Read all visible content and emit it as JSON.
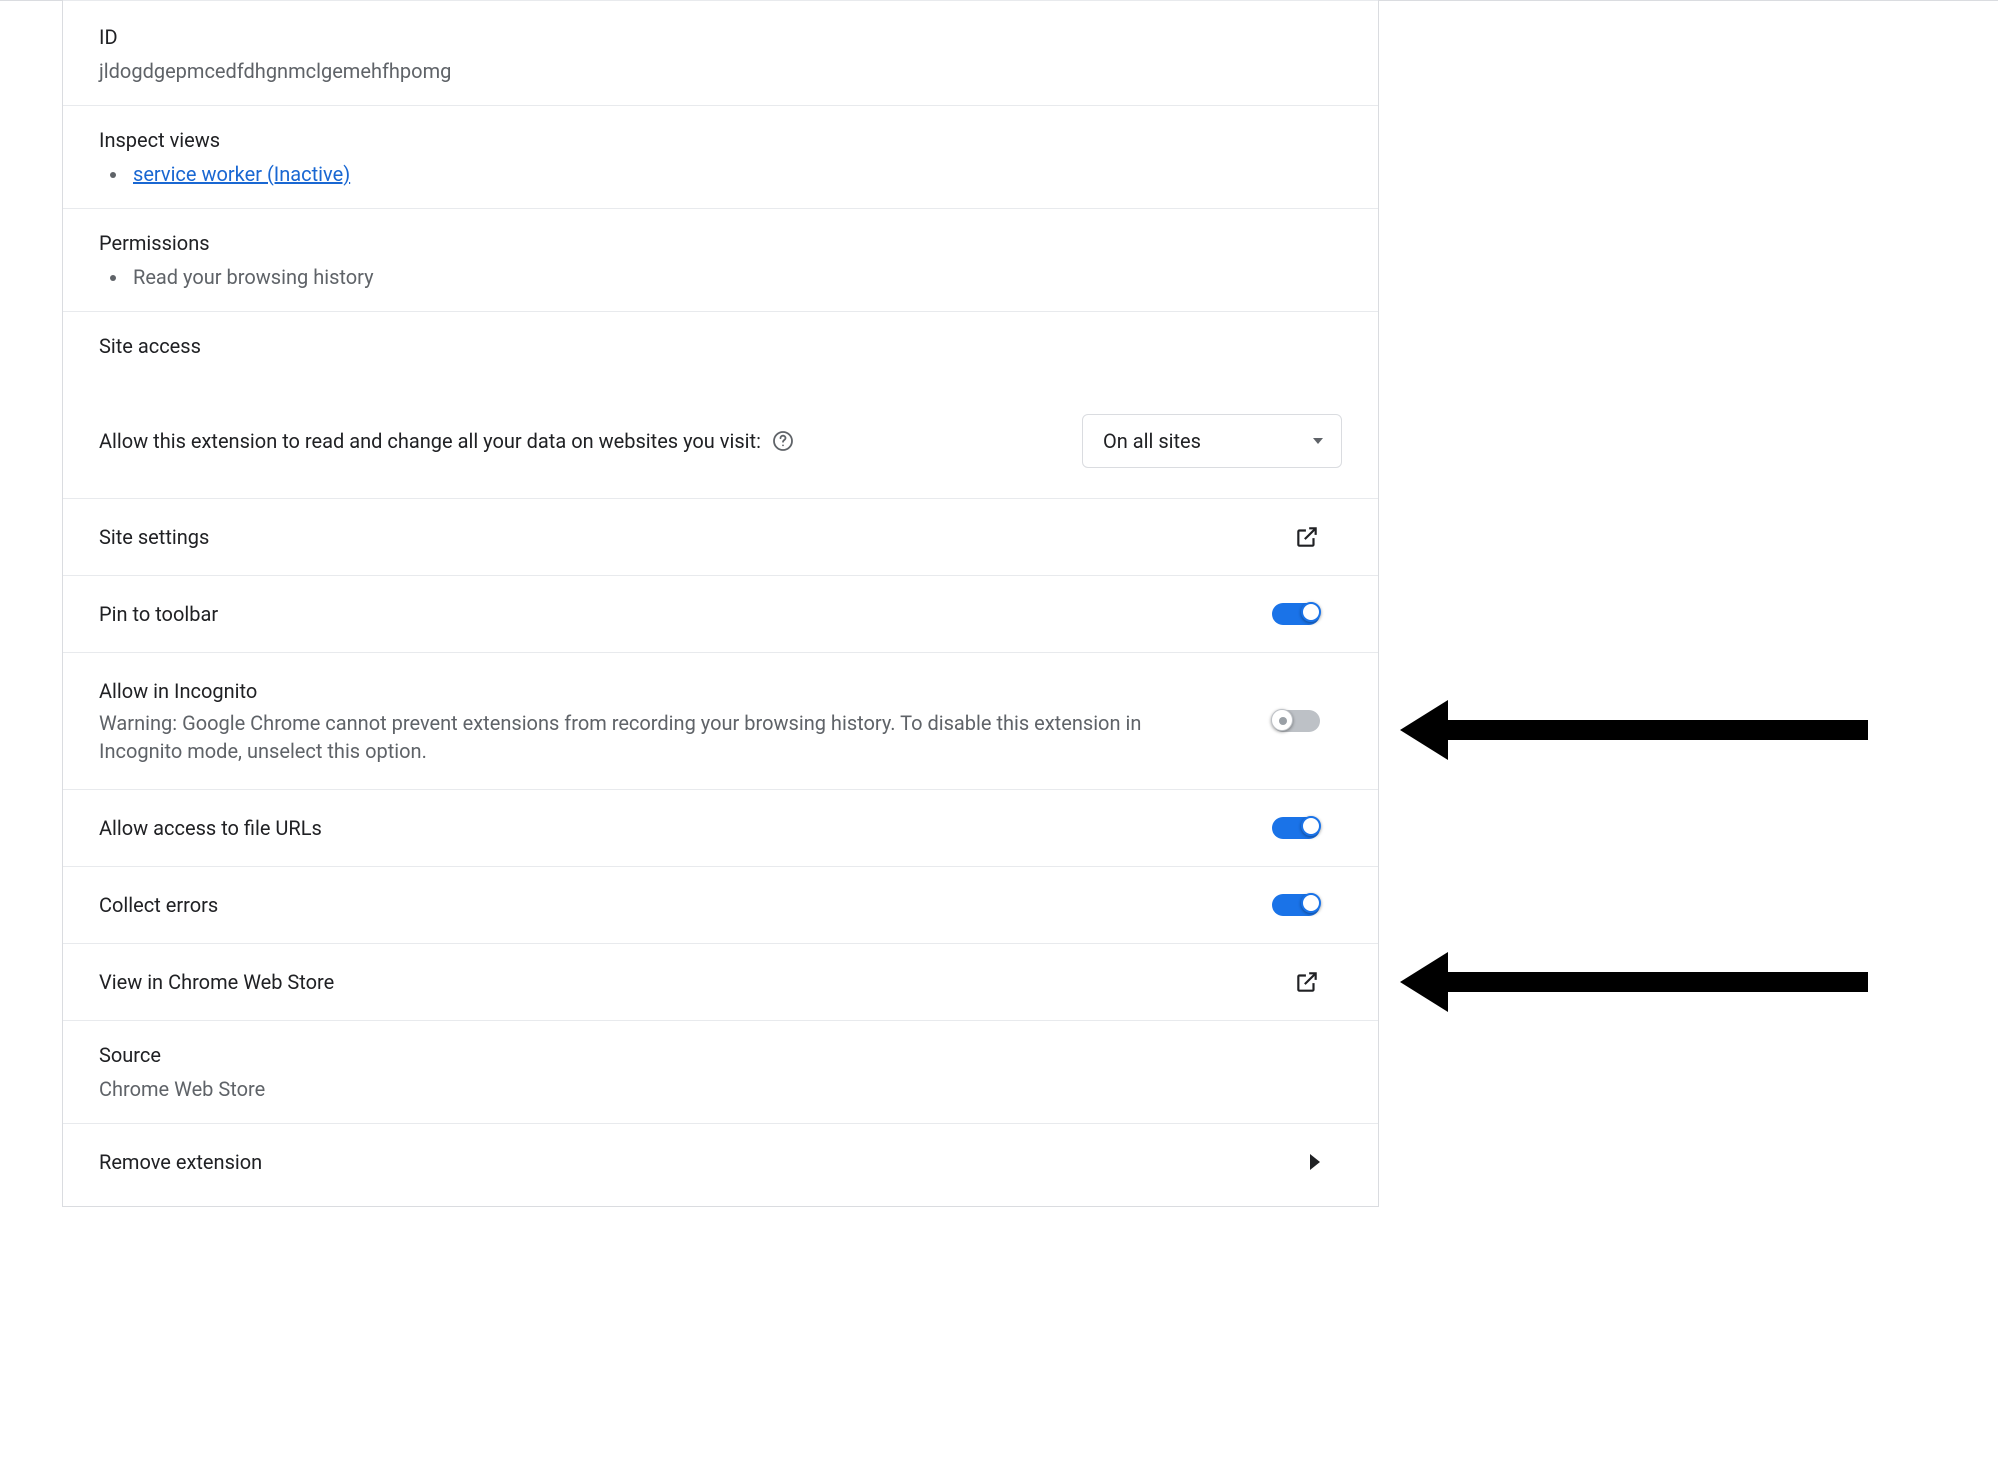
{
  "id_section": {
    "label": "ID",
    "value": "jldogdgepmcedfdhgnmclgemehfhpomg"
  },
  "inspect_views": {
    "label": "Inspect views",
    "link_text": "service worker (Inactive)"
  },
  "permissions": {
    "label": "Permissions",
    "items": [
      "Read your browsing history"
    ]
  },
  "site_access": {
    "label": "Site access",
    "prompt": "Allow this extension to read and change all your data on websites you visit:",
    "dropdown_value": "On all sites"
  },
  "site_settings": {
    "label": "Site settings"
  },
  "pin_to_toolbar": {
    "label": "Pin to toolbar",
    "enabled": true
  },
  "allow_incognito": {
    "label": "Allow in Incognito",
    "warning": "Warning: Google Chrome cannot prevent extensions from recording your browsing history. To disable this extension in Incognito mode, unselect this option.",
    "enabled": false
  },
  "allow_file_urls": {
    "label": "Allow access to file URLs",
    "enabled": true
  },
  "collect_errors": {
    "label": "Collect errors",
    "enabled": true
  },
  "view_in_store": {
    "label": "View in Chrome Web Store"
  },
  "source": {
    "label": "Source",
    "value": "Chrome Web Store"
  },
  "remove": {
    "label": "Remove extension"
  }
}
